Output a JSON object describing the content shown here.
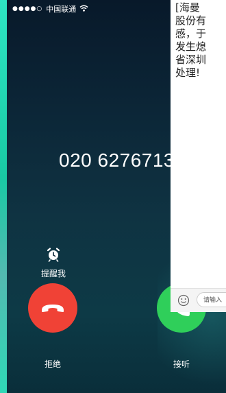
{
  "status_bar": {
    "signal": "●●●●○",
    "carrier": "中国联通",
    "wifi_icon": "wifi-icon"
  },
  "call": {
    "number": "020 6276713",
    "remind_label": "提醒我",
    "decline_label": "拒绝",
    "accept_label": "接听",
    "colors": {
      "decline": "#f04236",
      "accept": "#2fcf5a"
    }
  },
  "sms": {
    "lines": [
      "[海曼",
      "股份有",
      "感，于",
      "发生熄",
      "省深圳",
      "处理!"
    ],
    "input_placeholder": "请输入"
  }
}
